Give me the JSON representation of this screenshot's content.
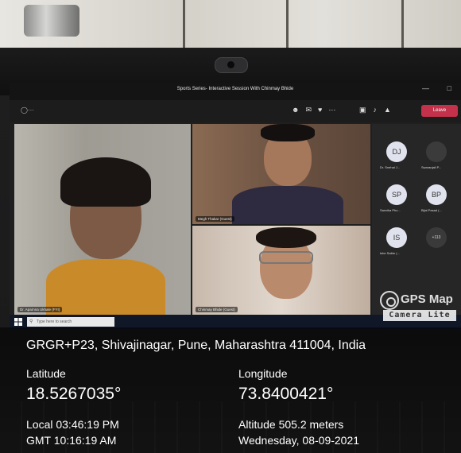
{
  "meeting": {
    "window_title": "Sports Series- Interactive Session With Chinmay Bhide",
    "leave_label": "Leave"
  },
  "participants_video": [
    {
      "label": "Dr. Aparnna Ukhale (FYI)"
    },
    {
      "label": "Megh Thakar (Guest)"
    },
    {
      "label": "Chinmay Bhide (Guest)"
    }
  ],
  "participants_panel": [
    {
      "initials": "DJ",
      "name": "Dr. Snehal J..."
    },
    {
      "initials": "",
      "name": "Swaranjali P..."
    },
    {
      "initials": "SP",
      "name": "Sanvika Phu..."
    },
    {
      "initials": "BP",
      "name": "Bijal Pasad (..."
    },
    {
      "initials": "IS",
      "name": "Ishe Sathe (..."
    }
  ],
  "more_count": "+113",
  "taskbar": {
    "search_placeholder": "Type here to search"
  },
  "watermark": {
    "title": "GPS Map",
    "subtitle": "Camera Lite"
  },
  "gps": {
    "address": "GRGR+P23, Shivajinagar, Pune, Maharashtra 411004, India",
    "latitude_label": "Latitude",
    "latitude": "18.5267035°",
    "longitude_label": "Longitude",
    "longitude": "73.8400421°",
    "local_time": "Local 03:46:19 PM",
    "gmt_time": "GMT 10:16:19 AM",
    "altitude": "Altitude 505.2 meters",
    "date": "Wednesday, 08-09-2021"
  }
}
